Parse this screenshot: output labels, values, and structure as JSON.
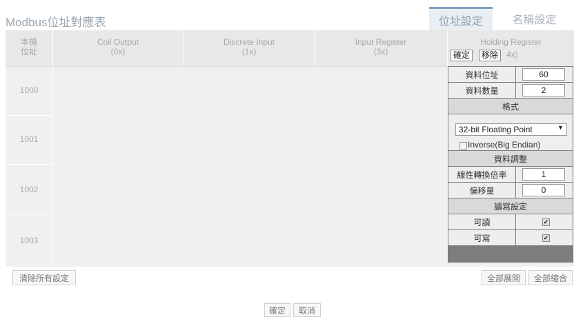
{
  "title": "Modbus位址對應表",
  "tabs": {
    "address": "位址設定",
    "name": "名稱設定"
  },
  "columns": {
    "local_address": [
      "本機",
      "位址"
    ],
    "coil": [
      "Coil Output",
      "(0x)"
    ],
    "discrete": [
      "Discrete Input",
      "(1x)"
    ],
    "input_register": [
      "Input Register",
      "(3x)"
    ],
    "holding": [
      "Holding Register",
      "4x)"
    ]
  },
  "holding_buttons": {
    "confirm": "確定",
    "remove": "移除"
  },
  "rows": [
    "1000",
    "1001",
    "1002",
    "1003"
  ],
  "panel": {
    "data_address_label": "資料位址",
    "data_address_value": "60",
    "data_count_label": "資料數量",
    "data_count_value": "2",
    "format_section": "格式",
    "format_selected": "32-bit Floating Point",
    "inverse_label": "Inverse(Big Endian)",
    "adjust_section": "資料調整",
    "scale_label": "線性轉換倍率",
    "scale_value": "1",
    "offset_label": "偏移量",
    "offset_value": "0",
    "rw_section": "讀寫設定",
    "readable_label": "可讀",
    "writable_label": "可寫"
  },
  "footer": {
    "clear_all": "清除所有設定",
    "expand_all": "全部展開",
    "collapse_all": "全部縮合",
    "confirm": "確定",
    "cancel": "取消"
  }
}
